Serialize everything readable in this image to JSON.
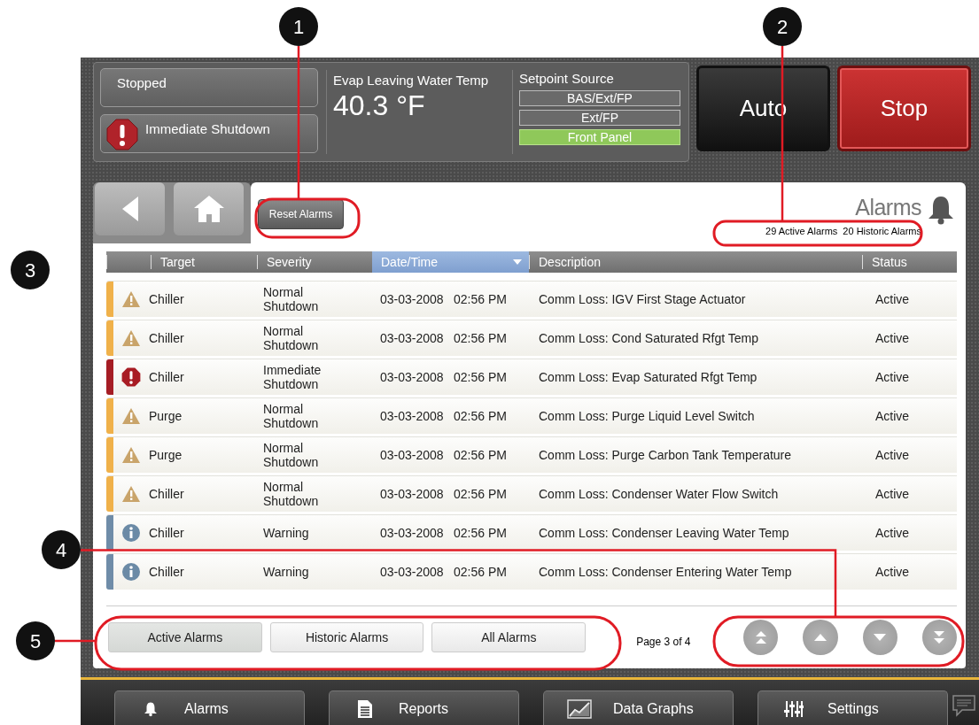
{
  "status": {
    "state": "Stopped",
    "alarm": "Immediate Shutdown"
  },
  "temperature": {
    "label": "Evap Leaving Water Temp",
    "value": "40.3 °F"
  },
  "setpoint_source": {
    "label": "Setpoint Source",
    "options": [
      {
        "label": "BAS/Ext/FP",
        "selected": false
      },
      {
        "label": "Ext/FP",
        "selected": false
      },
      {
        "label": "Front Panel",
        "selected": true
      }
    ]
  },
  "mode_buttons": [
    {
      "label": "Auto",
      "kind": "auto"
    },
    {
      "label": "Stop",
      "kind": "stop"
    }
  ],
  "reset_button": "Reset Alarms",
  "title": "Alarms",
  "counts": [
    "29 Active Alarms",
    "20 Historic Alarms"
  ],
  "table": {
    "columns": [
      {
        "label": "Target",
        "sorted": false
      },
      {
        "label": "Severity",
        "sorted": false
      },
      {
        "label": "Date/Time",
        "sorted": true
      },
      {
        "label": "Description",
        "sorted": false
      },
      {
        "label": "Status",
        "sorted": false
      }
    ],
    "rows": [
      {
        "kind": "warning",
        "target": "Chiller",
        "severity": "Normal Shutdown",
        "date": "03-03-2008",
        "time": "02:56 PM",
        "description": "Comm Loss: IGV First Stage Actuator",
        "status": "Active"
      },
      {
        "kind": "warning",
        "target": "Chiller",
        "severity": "Normal Shutdown",
        "date": "03-03-2008",
        "time": "02:56 PM",
        "description": "Comm Loss: Cond Saturated Rfgt Temp",
        "status": "Active"
      },
      {
        "kind": "shutdown",
        "target": "Chiller",
        "severity": "Immediate Shutdown",
        "date": "03-03-2008",
        "time": "02:56 PM",
        "description": "Comm Loss: Evap Saturated Rfgt Temp",
        "status": "Active"
      },
      {
        "kind": "warning",
        "target": "Purge",
        "severity": "Normal Shutdown",
        "date": "03-03-2008",
        "time": "02:56 PM",
        "description": "Comm Loss: Purge Liquid Level Switch",
        "status": "Active"
      },
      {
        "kind": "warning",
        "target": "Purge",
        "severity": "Normal Shutdown",
        "date": "03-03-2008",
        "time": "02:56 PM",
        "description": "Comm Loss: Purge Carbon Tank Temperature",
        "status": "Active"
      },
      {
        "kind": "warning",
        "target": "Chiller",
        "severity": "Normal Shutdown",
        "date": "03-03-2008",
        "time": "02:56 PM",
        "description": "Comm Loss: Condenser Water Flow Switch",
        "status": "Active"
      },
      {
        "kind": "info",
        "target": "Chiller",
        "severity": "Warning",
        "date": "03-03-2008",
        "time": "02:56 PM",
        "description": "Comm Loss: Condenser Leaving Water Temp",
        "status": "Active"
      },
      {
        "kind": "info",
        "target": "Chiller",
        "severity": "Warning",
        "date": "03-03-2008",
        "time": "02:56 PM",
        "description": "Comm Loss: Condenser Entering Water Temp",
        "status": "Active"
      }
    ]
  },
  "filters": [
    {
      "label": "Active Alarms",
      "selected": true
    },
    {
      "label": "Historic Alarms",
      "selected": false
    },
    {
      "label": "All Alarms",
      "selected": false
    }
  ],
  "page": "Page 3 of 4",
  "page_buttons": [
    {
      "kind": "first"
    },
    {
      "kind": "up"
    },
    {
      "kind": "down"
    },
    {
      "kind": "last"
    }
  ],
  "nav": [
    {
      "label": "Alarms",
      "kind": "bell"
    },
    {
      "label": "Reports",
      "kind": "document"
    },
    {
      "label": "Data Graphs",
      "kind": "graph"
    },
    {
      "label": "Settings",
      "kind": "sliders"
    }
  ],
  "callouts": [
    "1",
    "2",
    "3",
    "4",
    "5"
  ]
}
